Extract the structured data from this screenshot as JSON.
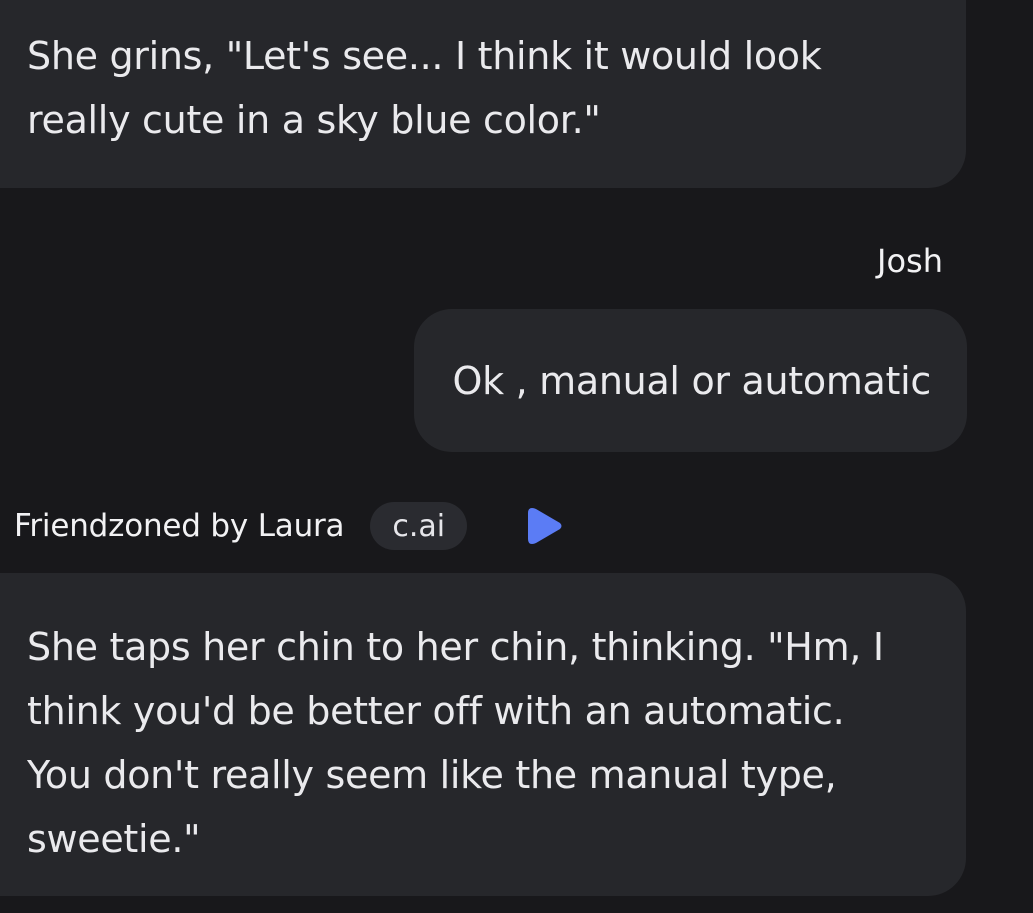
{
  "messages": [
    {
      "role": "bot",
      "text": "She grins, \"Let's see... I think it would look really cute in a sky blue color.\""
    },
    {
      "role": "user",
      "author": "Josh",
      "text": "Ok , manual or automatic"
    },
    {
      "role": "bot",
      "author": "Friendzoned by Laura",
      "badge": "c.ai",
      "text": "She taps her chin to her chin, thinking. \"Hm, I think you'd be better off with an automatic. You don't really seem like the manual type, sweetie.\""
    }
  ],
  "icons": {
    "play": "play-icon"
  },
  "colors": {
    "background": "#18181b",
    "bubble": "#26272b",
    "badge": "#2a2b30",
    "play_accent": "#5b7cf5",
    "text": "#eaeaed"
  }
}
